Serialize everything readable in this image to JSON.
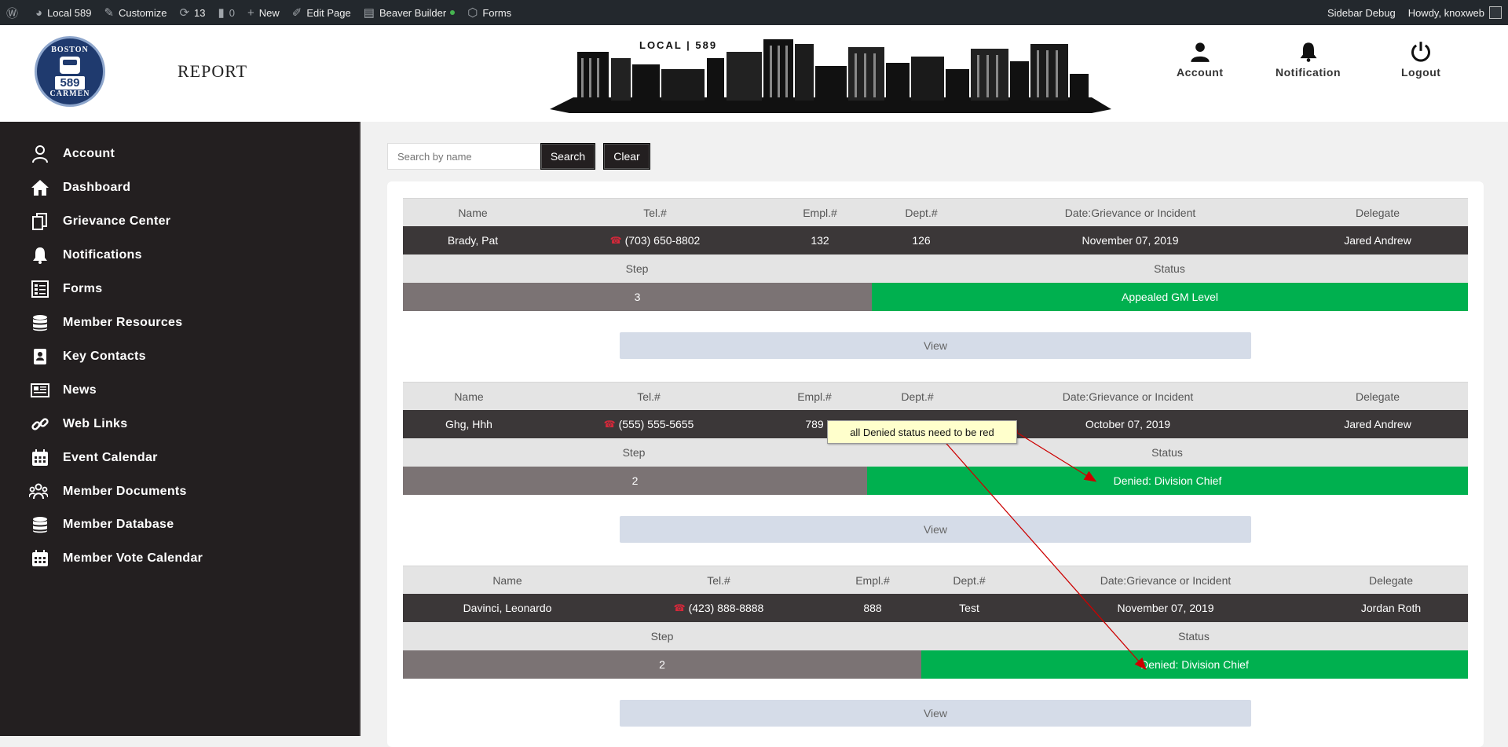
{
  "adminbar": {
    "site": "Local 589",
    "customize": "Customize",
    "updates": "13",
    "comments": "0",
    "new": "New",
    "edit_page": "Edit Page",
    "beaver": "Beaver Builder",
    "forms": "Forms",
    "sidebar_debug": "Sidebar Debug",
    "howdy": "Howdy, knoxweb"
  },
  "header": {
    "logo_top": "BOSTON",
    "logo_num": "589",
    "logo_bottom": "CARMEN",
    "title": "REPORT",
    "skyline_text": "LOCAL  |  589",
    "account": "Account",
    "notification": "Notification",
    "logout": "Logout"
  },
  "sidebar": {
    "items": [
      {
        "label": "Account",
        "icon": "user-icon"
      },
      {
        "label": "Dashboard",
        "icon": "home-icon"
      },
      {
        "label": "Grievance Center",
        "icon": "copy-icon"
      },
      {
        "label": "Notifications",
        "icon": "bell-icon"
      },
      {
        "label": "Forms",
        "icon": "form-icon"
      },
      {
        "label": "Member Resources",
        "icon": "database-icon"
      },
      {
        "label": "Key Contacts",
        "icon": "contact-book-icon"
      },
      {
        "label": "News",
        "icon": "newspaper-icon"
      },
      {
        "label": "Web Links",
        "icon": "link-icon"
      },
      {
        "label": "Event Calendar",
        "icon": "calendar-icon"
      },
      {
        "label": "Member Documents",
        "icon": "users-icon"
      },
      {
        "label": "Member Database",
        "icon": "database-icon"
      },
      {
        "label": "Member Vote Calendar",
        "icon": "calendar-icon"
      }
    ]
  },
  "search": {
    "placeholder": "Search by name",
    "search_label": "Search",
    "clear_label": "Clear"
  },
  "columns": {
    "name": "Name",
    "tel": "Tel.#",
    "empl": "Empl.#",
    "dept": "Dept.#",
    "date": "Date:Grievance or Incident",
    "delegate": "Delegate",
    "step": "Step",
    "status": "Status",
    "view": "View"
  },
  "records": [
    {
      "name": "Brady, Pat",
      "tel": "(703) 650-8802",
      "empl": "132",
      "dept": "126",
      "date": "November 07, 2019",
      "delegate": "Jared Andrew",
      "step": "3",
      "status": "Appealed GM Level"
    },
    {
      "name": "Ghg, Hhh",
      "tel": "(555) 555-5655",
      "empl": "789",
      "dept": "",
      "date": "October 07, 2019",
      "delegate": "Jared Andrew",
      "step": "2",
      "status": "Denied: Division Chief"
    },
    {
      "name": "Davinci, Leonardo",
      "tel": "(423) 888-8888",
      "empl": "888",
      "dept": "Test",
      "date": "November 07, 2019",
      "delegate": "Jordan Roth",
      "step": "2",
      "status": "Denied: Division Chief"
    }
  ],
  "annotation": {
    "text": "all Denied status need to be red"
  },
  "colors": {
    "status_green": "#00b04f",
    "sidebar_bg": "#231f20",
    "arrow_red": "#cc0000"
  }
}
